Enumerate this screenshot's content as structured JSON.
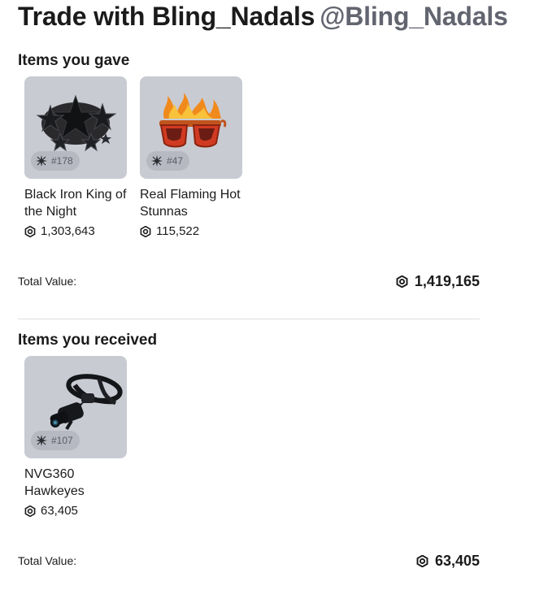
{
  "header": {
    "title": "Trade with Bling_Nadals",
    "handle": "@Bling_Nadals"
  },
  "gave": {
    "heading": "Items you gave",
    "items": [
      {
        "name": "Black Iron King of the Night",
        "serial": "#178",
        "price": "1,303,643",
        "icon": "black-star-crown-icon"
      },
      {
        "name": "Real Flaming Hot Stunnas",
        "serial": "#47",
        "price": "115,522",
        "icon": "flaming-sunglasses-icon"
      }
    ],
    "total_label": "Total Value:",
    "total_value": "1,419,165"
  },
  "received": {
    "heading": "Items you received",
    "items": [
      {
        "name": "NVG360 Hawkeyes",
        "serial": "#107",
        "price": "63,405",
        "icon": "night-vision-goggles-icon"
      }
    ],
    "total_label": "Total Value:",
    "total_value": "63,405"
  },
  "colors": {
    "thumb_background": "#c9cbd3",
    "handle_text": "#62656f",
    "divider": "#dcdde2"
  }
}
